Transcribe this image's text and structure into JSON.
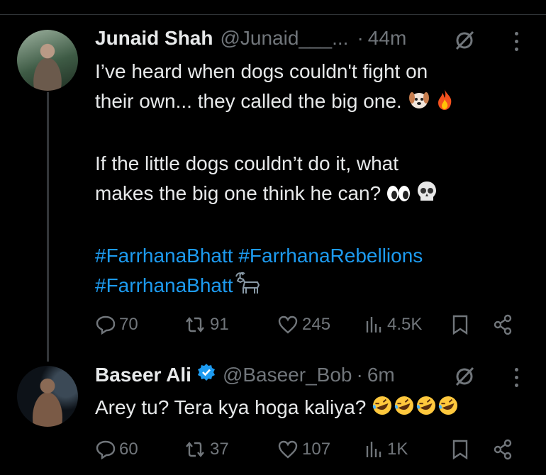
{
  "tweets": [
    {
      "name": "Junaid Shah",
      "handle": "@Junaid___...",
      "dot": "·",
      "time": "44m",
      "verified": false,
      "lines": [
        "I’ve heard when dogs couldn't fight on",
        "their own... they called the big one.",
        "If the little dogs couldn’t do it, what",
        "makes the big one think he can?"
      ],
      "hashtags": [
        "#FarrhanaBhatt",
        "#FarrhanaRebellions",
        "#FarrhanaBhatt"
      ],
      "stats": {
        "replies": "70",
        "reposts": "91",
        "likes": "245",
        "views": "4.5K"
      }
    },
    {
      "name": "Baseer Ali",
      "handle": "@Baseer_Bob",
      "dot": "·",
      "time": "6m",
      "verified": true,
      "lines": [
        "Arey tu? Tera kya hoga kaliya?"
      ],
      "stats": {
        "replies": "60",
        "reposts": "37",
        "likes": "107",
        "views": "1K"
      }
    }
  ],
  "colors": {
    "hashtag": "#1d9bf0",
    "muted": "#71767b",
    "verified": "#1d9bf0",
    "background": "#000000"
  }
}
